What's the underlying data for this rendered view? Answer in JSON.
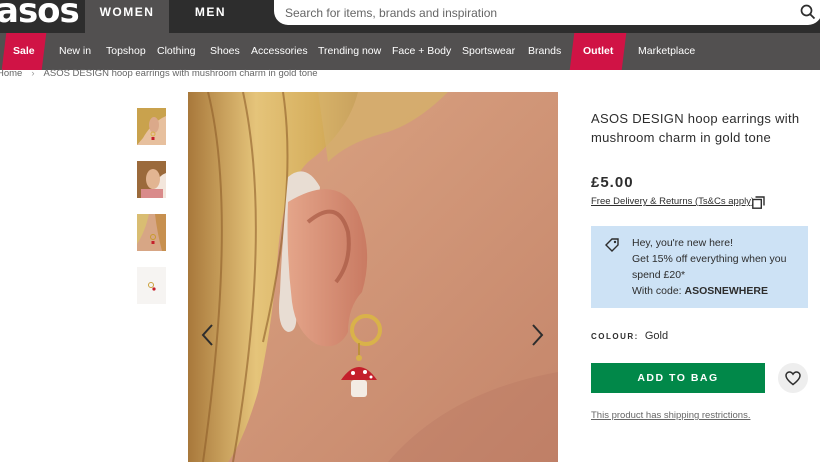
{
  "header": {
    "logo": "asos",
    "tabs": [
      {
        "label": "WOMEN"
      },
      {
        "label": "MEN"
      }
    ],
    "search": {
      "placeholder": "Search for items, brands and inspiration",
      "value": ""
    }
  },
  "nav": {
    "items": [
      {
        "label": "Sale"
      },
      {
        "label": "New in"
      },
      {
        "label": "Topshop"
      },
      {
        "label": "Clothing"
      },
      {
        "label": "Shoes"
      },
      {
        "label": "Accessories"
      },
      {
        "label": "Trending now"
      },
      {
        "label": "Face + Body"
      },
      {
        "label": "Sportswear"
      },
      {
        "label": "Brands"
      },
      {
        "label": "Outlet"
      },
      {
        "label": "Marketplace"
      }
    ],
    "highlight_color": "#d01345"
  },
  "breadcrumb": {
    "home": "Home",
    "separator": "›",
    "current": "ASOS DESIGN hoop earrings with mushroom charm in gold tone"
  },
  "product": {
    "title": "ASOS DESIGN hoop earrings with mushroom charm in gold tone",
    "price": "£5.00",
    "delivery_link": "Free Delivery & Returns (Ts&Cs apply)",
    "promo": {
      "line1": "Hey, you're new here!",
      "line2": "Get 15% off everything when you",
      "line3": "spend £20*",
      "code_label": "With code: ",
      "code": "ASOSNEWHERE"
    },
    "colour_label": "COLOUR:",
    "colour_value": "Gold",
    "add_to_bag": "ADD TO BAG",
    "shipping_note": "This product has shipping restrictions.",
    "button_color": "#018849"
  },
  "icons": [
    "search-icon",
    "copy-icon",
    "tag-icon",
    "heart-icon",
    "chevron-left-icon",
    "chevron-right-icon"
  ]
}
